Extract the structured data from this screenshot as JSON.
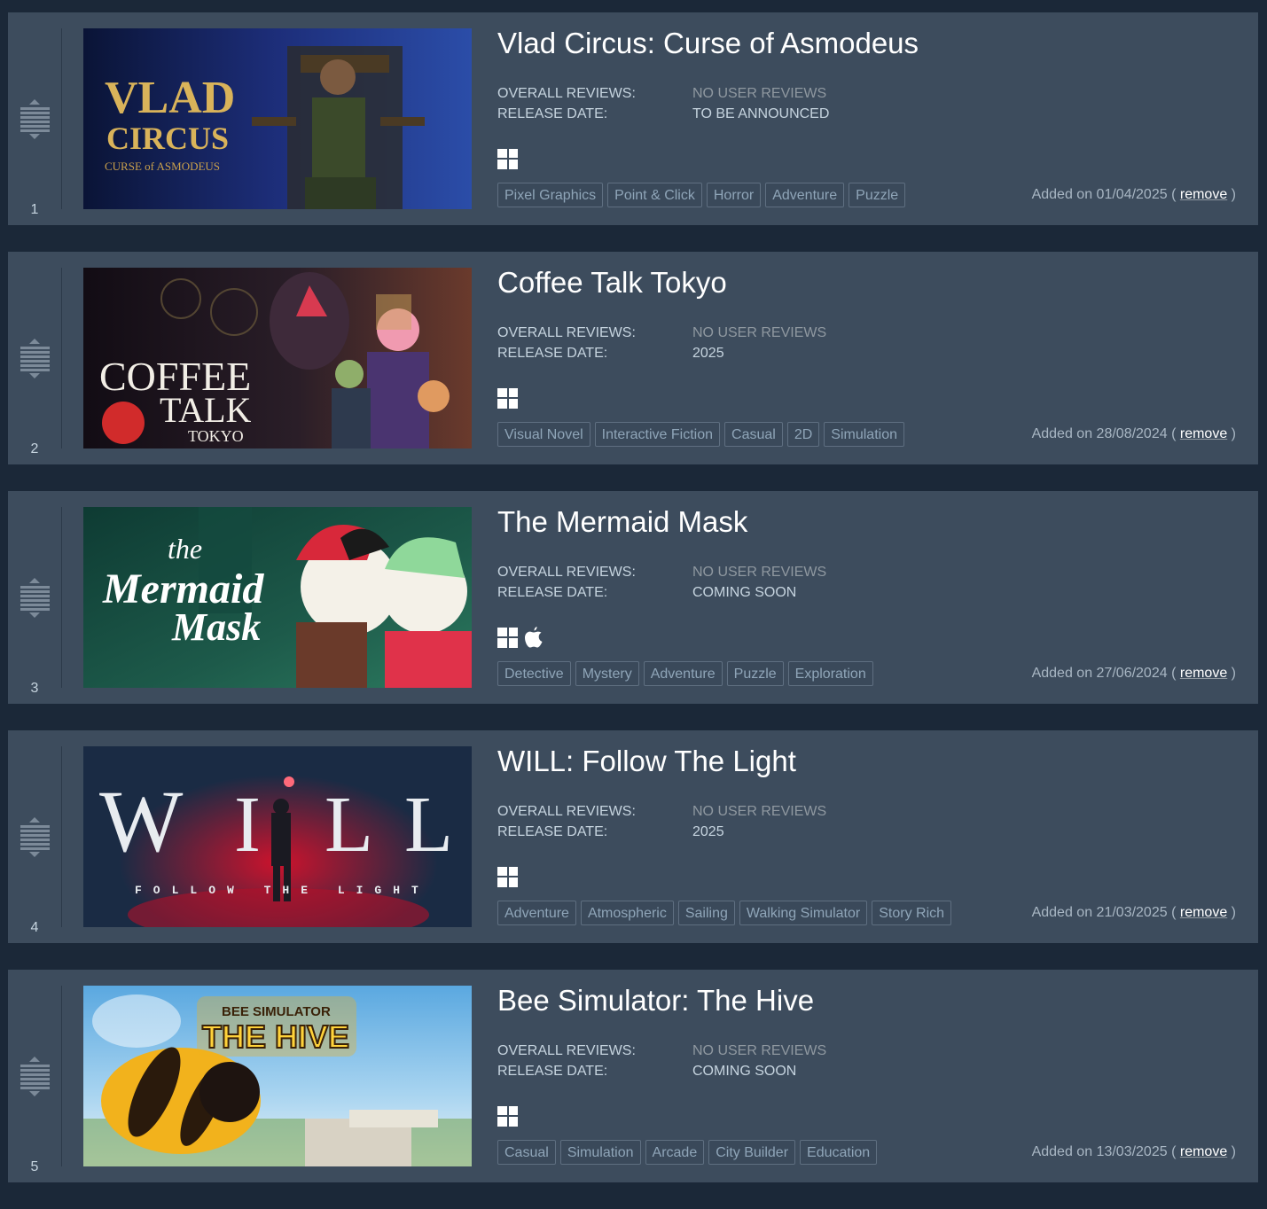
{
  "labels": {
    "overall_reviews": "OVERALL REVIEWS:",
    "release_date": "RELEASE DATE:",
    "added_prefix": "Added on",
    "open_paren": "(",
    "close_paren": ")",
    "remove": "remove"
  },
  "items": [
    {
      "rank": "1",
      "title": "Vlad Circus: Curse of Asmodeus",
      "reviews": "NO USER REVIEWS",
      "release": "TO BE ANNOUNCED",
      "platforms": [
        "windows-icon"
      ],
      "tags": [
        "Pixel Graphics",
        "Point & Click",
        "Horror",
        "Adventure",
        "Puzzle"
      ],
      "added": "01/04/2025",
      "capsule_logo": [
        "VLAD",
        "CIRCUS",
        "CURSE of ASMODEUS"
      ],
      "colors": {
        "bg1": "#0a1436",
        "bg2": "#2b4da8",
        "accent": "#d9b35a"
      }
    },
    {
      "rank": "2",
      "title": "Coffee Talk Tokyo",
      "reviews": "NO USER REVIEWS",
      "release": "2025",
      "platforms": [
        "windows-icon"
      ],
      "tags": [
        "Visual Novel",
        "Interactive Fiction",
        "Casual",
        "2D",
        "Simulation"
      ],
      "added": "28/08/2024",
      "capsule_logo": [
        "COFFEE",
        "TALK",
        "TOKYO"
      ],
      "colors": {
        "bg1": "#1a0f14",
        "bg2": "#5a2f2a",
        "accent": "#d12b2b"
      }
    },
    {
      "rank": "3",
      "title": "The Mermaid Mask",
      "reviews": "NO USER REVIEWS",
      "release": "COMING SOON",
      "platforms": [
        "windows-icon",
        "apple-icon"
      ],
      "tags": [
        "Detective",
        "Mystery",
        "Adventure",
        "Puzzle",
        "Exploration"
      ],
      "added": "27/06/2024",
      "capsule_logo": [
        "the",
        "Mermaid",
        "Mask"
      ],
      "colors": {
        "bg1": "#0e3b33",
        "bg2": "#2c7a5f",
        "accent": "#e0324a"
      }
    },
    {
      "rank": "4",
      "title": "WILL: Follow The Light",
      "reviews": "NO USER REVIEWS",
      "release": "2025",
      "platforms": [
        "windows-icon"
      ],
      "tags": [
        "Adventure",
        "Atmospheric",
        "Sailing",
        "Walking Simulator",
        "Story Rich"
      ],
      "added": "21/03/2025",
      "capsule_logo": [
        "W",
        "I",
        "L",
        "L",
        "FOLLOW THE LIGHT"
      ],
      "colors": {
        "bg1": "#0d1a2e",
        "bg2": "#243a5a",
        "accent": "#e0102a"
      }
    },
    {
      "rank": "5",
      "title": "Bee Simulator: The Hive",
      "reviews": "NO USER REVIEWS",
      "release": "COMING SOON",
      "platforms": [
        "windows-icon"
      ],
      "tags": [
        "Casual",
        "Simulation",
        "Arcade",
        "City Builder",
        "Education"
      ],
      "added": "13/03/2025",
      "capsule_logo": [
        "BEE SIMULATOR",
        "THE HIVE"
      ],
      "colors": {
        "bg1": "#6fb6e6",
        "bg2": "#e8f2f8",
        "accent": "#f2b21c"
      }
    }
  ]
}
